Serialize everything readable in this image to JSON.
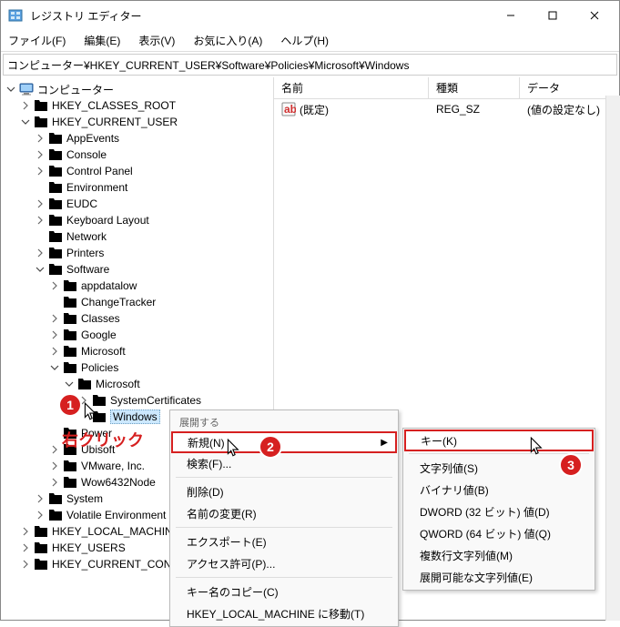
{
  "title": "レジストリ エディター",
  "menu": {
    "file": "ファイル(F)",
    "edit": "編集(E)",
    "view": "表示(V)",
    "fav": "お気に入り(A)",
    "help": "ヘルプ(H)"
  },
  "address": "コンピューター¥HKEY_CURRENT_USER¥Software¥Policies¥Microsoft¥Windows",
  "cols": {
    "name": "名前",
    "type": "種類",
    "data": "データ"
  },
  "row": {
    "name": "(既定)",
    "type": "REG_SZ",
    "data": "(値の設定なし)"
  },
  "tree": {
    "root": "コンピューター",
    "hkcr": "HKEY_CLASSES_ROOT",
    "hkcu": "HKEY_CURRENT_USER",
    "appevents": "AppEvents",
    "console": "Console",
    "cp": "Control Panel",
    "env": "Environment",
    "eudc": "EUDC",
    "kbd": "Keyboard Layout",
    "net": "Network",
    "prn": "Printers",
    "sw": "Software",
    "appdata": "appdatalow",
    "ct": "ChangeTracker",
    "classes": "Classes",
    "google": "Google",
    "ms": "Microsoft",
    "pol": "Policies",
    "pol_ms": "Microsoft",
    "syscert": "SystemCertificates",
    "win": "Windows",
    "power": "Power",
    "right": "右クリック",
    "ubi": "Ubisoft",
    "vmw": "VMware, Inc.",
    "wow": "Wow6432Node",
    "sys": "System",
    "venv": "Volatile Environment",
    "hklm": "HKEY_LOCAL_MACHINE",
    "hku": "HKEY_USERS",
    "hkcc": "HKEY_CURRENT_CONFIG"
  },
  "ctx1": {
    "header": "展開する",
    "new": "新規(N)",
    "find": "検索(F)...",
    "delete": "削除(D)",
    "rename": "名前の変更(R)",
    "export": "エクスポート(E)",
    "perm": "アクセス許可(P)...",
    "copy": "キー名のコピー(C)",
    "jump": "HKEY_LOCAL_MACHINE に移動(T)"
  },
  "ctx2": {
    "key": "キー(K)",
    "str": "文字列値(S)",
    "bin": "バイナリ値(B)",
    "dw": "DWORD (32 ビット) 値(D)",
    "qw": "QWORD (64 ビット) 値(Q)",
    "mstr": "複数行文字列値(M)",
    "estr": "展開可能な文字列値(E)"
  }
}
